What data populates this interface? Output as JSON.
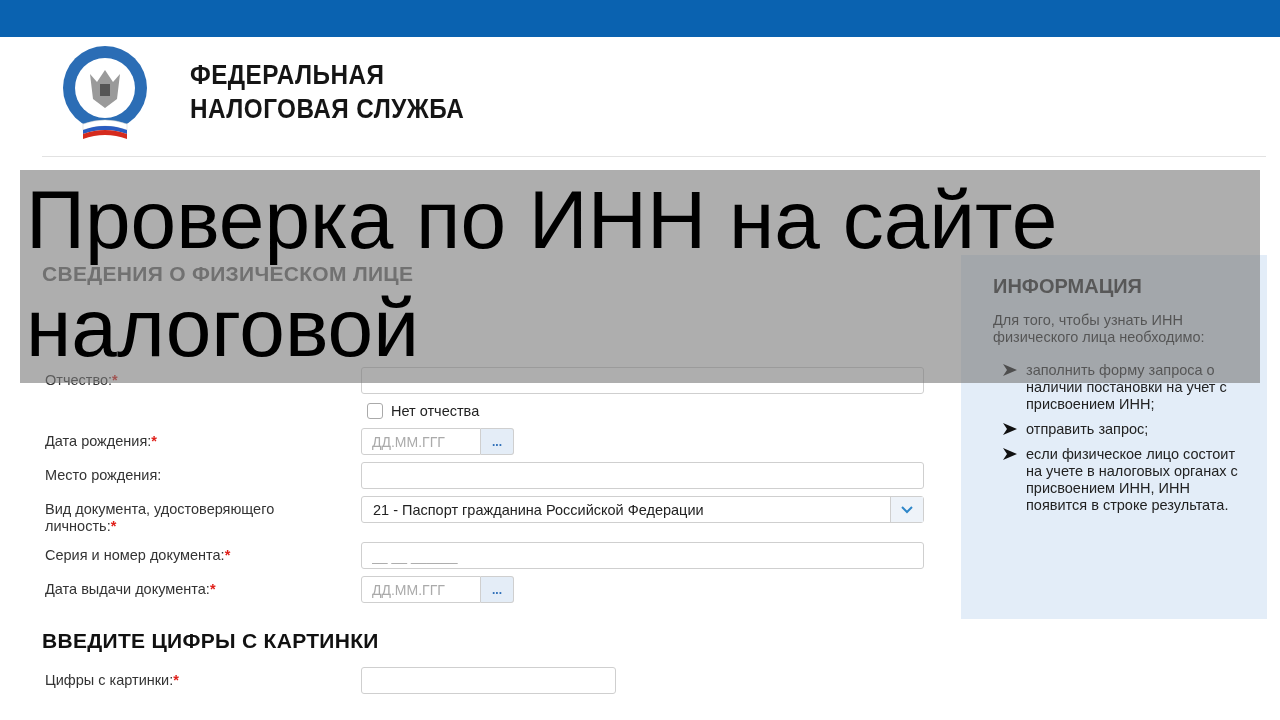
{
  "header": {
    "org_name": [
      "ФЕДЕРАЛЬНАЯ",
      "НАЛОГОВАЯ СЛУЖБА"
    ]
  },
  "personal_section": {
    "heading": "СВЕДЕНИЯ О ФИЗИЧЕСКОМ ЛИЦЕ",
    "fields": [
      {
        "kind": "text",
        "label": "Отчество:",
        "required_mark": "*"
      },
      {
        "kind": "checkbox",
        "label": "Нет отчества",
        "checked": false
      },
      {
        "kind": "date",
        "label": "Дата рождения:",
        "required_mark": "*",
        "placeholder": "ДД.ММ.ГГГ",
        "button": "..."
      },
      {
        "kind": "text",
        "label": "Место рождения:"
      },
      {
        "kind": "select",
        "label": "Вид документа, удостоверяющего личность:",
        "required_mark": "*",
        "value": "21 - Паспорт гражданина Российской Федерации"
      },
      {
        "kind": "text",
        "label": "Серия и номер документа:",
        "required_mark": "*",
        "placeholder": "__ __ ______"
      },
      {
        "kind": "date",
        "label": "Дата выдачи документа:",
        "required_mark": "*",
        "placeholder": "ДД.ММ.ГГГ",
        "button": "..."
      }
    ]
  },
  "captcha_section": {
    "heading": "ВВЕДИТЕ ЦИФРЫ С КАРТИНКИ",
    "fields": [
      {
        "kind": "short",
        "label": "Цифры с картинки:",
        "required_mark": "*"
      }
    ]
  },
  "info_panel": {
    "heading": "ИНФОРМАЦИЯ",
    "intro": "Для того, чтобы узнать ИНН физического лица необходимо:",
    "items": [
      "заполнить форму запроса о наличии постановки на учет с присвоением ИНН;",
      "отправить запрос;",
      "если физическое лицо состоит на учете в налоговых органах с присвоением ИНН, ИНН появится в строке результата."
    ]
  },
  "caption_lines": [
    "Проверка по ИНН на сайте",
    "налоговой"
  ]
}
